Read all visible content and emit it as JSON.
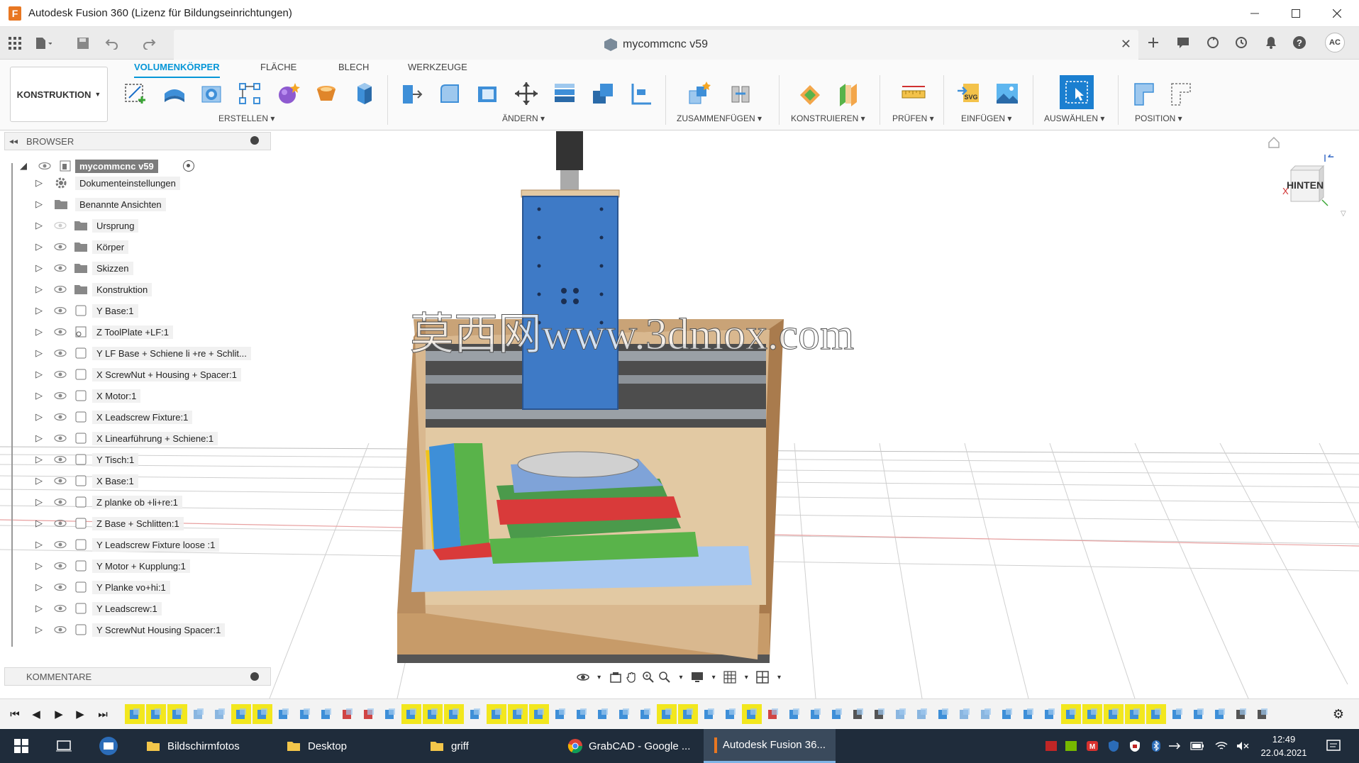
{
  "window": {
    "title": "Autodesk Fusion 360 (Lizenz für Bildungseinrichtungen)",
    "app_icon_letter": "F",
    "controls": [
      "minimize",
      "maximize",
      "close"
    ]
  },
  "document_tab": {
    "label": "mycommcnc v59"
  },
  "quick_access": {
    "user_initials": "AC"
  },
  "ribbon": {
    "workspace": "KONSTRUKTION",
    "tabs": [
      {
        "label": "VOLUMENKÖRPER",
        "active": true
      },
      {
        "label": "FLÄCHE",
        "active": false
      },
      {
        "label": "BLECH",
        "active": false
      },
      {
        "label": "WERKZEUGE",
        "active": false
      }
    ],
    "groups": {
      "erstellen": "ERSTELLEN",
      "aendern": "ÄNDERN",
      "zusammenfuegen": "ZUSAMMENFÜGEN",
      "konstruieren": "KONSTRUIEREN",
      "pruefen": "PRÜFEN",
      "einfuegen": "EINFÜGEN",
      "auswaehlen": "AUSWÄHLEN",
      "position": "POSITION"
    },
    "accent_color": "#0696d7"
  },
  "browser": {
    "title": "BROWSER",
    "root": "mycommcnc v59",
    "items": [
      "Dokumenteinstellungen",
      "Benannte Ansichten",
      "Ursprung",
      "Körper",
      "Skizzen",
      "Konstruktion",
      "Y Base:1",
      "Z ToolPlate +LF:1",
      "Y LF Base + Schiene li +re + Schlit...",
      "X ScrewNut + Housing + Spacer:1",
      "X  Motor:1",
      "X Leadscrew Fixture:1",
      "X Linearführung + Schiene:1",
      "Y Tisch:1",
      "X Base:1",
      "Z planke ob +li+re:1",
      "Z Base + Schlitten:1",
      "Y Leadscrew Fixture loose :1",
      "Y Motor + Kupplung:1",
      "Y Planke vo+hi:1",
      "Y Leadscrew:1",
      "Y ScrewNut Housing Spacer:1"
    ]
  },
  "comments": {
    "title": "KOMMENTARE"
  },
  "viewcube": {
    "face": "HINTEN",
    "axis_z": "Z",
    "axis_x": "X"
  },
  "watermark": "莫西网www.3dmox.com",
  "taskbar": {
    "items": [
      {
        "label": "Bildschirmfotos",
        "icon": "folder-icon"
      },
      {
        "label": "Desktop",
        "icon": "folder-icon"
      },
      {
        "label": "griff",
        "icon": "folder-icon"
      },
      {
        "label": "GrabCAD - Google ...",
        "icon": "chrome-icon"
      },
      {
        "label": "Autodesk Fusion 36...",
        "icon": "fusion-icon",
        "active": true
      }
    ],
    "time": "12:49",
    "date": "22.04.2021"
  }
}
